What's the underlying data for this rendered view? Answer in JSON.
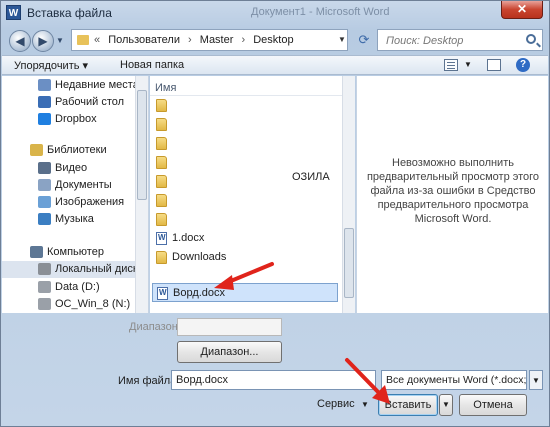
{
  "window": {
    "title": "Вставка файла",
    "ghost_title": "Документ1 - Microsoft Word",
    "app_icon": "W",
    "close_label": "✕"
  },
  "address": {
    "crumbs": [
      "Пользователи",
      "Master",
      "Desktop"
    ],
    "search_placeholder": "Поиск: Desktop"
  },
  "toolbar": {
    "organize_label": "Упорядочить ▾",
    "new_folder_label": "Новая папка"
  },
  "nav": {
    "items": [
      {
        "label": "Недавние места",
        "icon": "recent-places-icon",
        "color": "#6b8fc4"
      },
      {
        "label": "Рабочий стол",
        "icon": "desktop-icon",
        "color": "#3a6db5"
      },
      {
        "label": "Dropbox",
        "icon": "dropbox-icon",
        "color": "#1f7fe0"
      },
      {
        "label": "Библиотеки",
        "icon": "libraries-icon",
        "color": "#d9b44a"
      },
      {
        "label": "Видео",
        "icon": "video-icon",
        "color": "#5a6f8a"
      },
      {
        "label": "Документы",
        "icon": "documents-icon",
        "color": "#8aa3c4"
      },
      {
        "label": "Изображения",
        "icon": "images-icon",
        "color": "#6aa0d6"
      },
      {
        "label": "Музыка",
        "icon": "music-icon",
        "color": "#3b7ec2"
      },
      {
        "label": "Компьютер",
        "icon": "computer-icon",
        "color": "#5d7795"
      },
      {
        "label": "Локальный диск",
        "icon": "local-disk-icon",
        "color": "#8a8f96"
      },
      {
        "label": "Data (D:)",
        "icon": "drive-icon",
        "color": "#9aa0a8"
      },
      {
        "label": "OC_Win_8 (N:)",
        "icon": "drive-icon",
        "color": "#9aa0a8"
      }
    ]
  },
  "files": {
    "column_name": "Имя",
    "rows": [
      {
        "name": "",
        "type": "folder"
      },
      {
        "name": "",
        "type": "folder"
      },
      {
        "name": "",
        "type": "folder"
      },
      {
        "name": "",
        "type": "folder"
      },
      {
        "name": "",
        "type": "folder"
      },
      {
        "name": "",
        "type": "folder"
      },
      {
        "name": "",
        "type": "folder"
      },
      {
        "name": "1.docx",
        "type": "docx"
      },
      {
        "name": "Downloads",
        "type": "downloads"
      },
      {
        "name": "Ворд.docx",
        "type": "docx",
        "selected": true
      }
    ],
    "stray_text": "ОЗИЛА"
  },
  "preview": {
    "message": "Невозможно выполнить предварительный просмотр этого файла из-за ошибки в Средство предварительного просмотра Microsoft Word."
  },
  "bottom": {
    "range_label": "Диапазон:",
    "range_button": "Диапазон...",
    "filename_label": "Имя файла:",
    "filename_value": "Ворд.docx",
    "filter_value": "Все документы Word (*.docx;*",
    "service_label": "Сервис",
    "insert_label": "Вставить",
    "cancel_label": "Отмена"
  },
  "colors": {
    "annotation_arrow": "#e0241b",
    "selection": "#cfe3fb"
  }
}
